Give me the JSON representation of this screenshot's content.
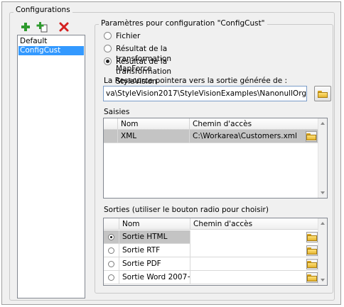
{
  "configurations": {
    "title": "Configurations",
    "items": [
      {
        "label": "Default",
        "selected": false
      },
      {
        "label": "ConfigCust",
        "selected": true
      }
    ],
    "toolbar": {
      "add_icon": "add-plus-icon",
      "add_copy_icon": "add-copy-icon",
      "delete_icon": "delete-x-icon"
    }
  },
  "params": {
    "title": "Paramètres pour configuration \"ConfigCust\"",
    "radios": [
      {
        "label": "Fichier",
        "checked": false
      },
      {
        "label": "Résultat de la transformation MapForce",
        "checked": false
      },
      {
        "label": "Résultat de la transformation StyleVision",
        "checked": true
      }
    ],
    "resource_label": "La Ressource pointera vers la sortie générée de :",
    "resource_value": "va\\StyleVision2017\\StyleVisionExamples\\NanonullOrg.sps"
  },
  "saisies": {
    "label": "Saisies",
    "columns": [
      "Nom",
      "Chemin d'accès"
    ],
    "rows": [
      {
        "name": "XML",
        "path": "C:\\Workarea\\Customers.xml",
        "selected": true
      }
    ]
  },
  "sorties": {
    "label": "Sorties (utiliser le bouton radio pour choisir)",
    "columns": [
      "Nom",
      "Chemin d'accès"
    ],
    "rows": [
      {
        "name": "Sortie HTML",
        "path": "",
        "checked": true
      },
      {
        "name": "Sortie RTF",
        "path": "",
        "checked": false
      },
      {
        "name": "Sortie PDF",
        "path": "",
        "checked": false
      },
      {
        "name": "Sortie Word 2007+",
        "path": "",
        "checked": false
      }
    ]
  },
  "colors": {
    "selection": "#3399ff",
    "row_selected": "#c4c4c4",
    "add_green": "#2e9a2e",
    "delete_red": "#d42020"
  }
}
